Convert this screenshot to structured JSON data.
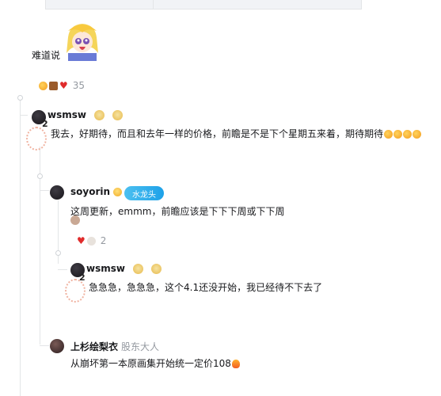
{
  "top_comment": {
    "text": "难道说",
    "reactions_count": "35"
  },
  "comments": [
    {
      "username": "wsmsw",
      "avatar_badge": "2",
      "text": "我去，好期待，而且和去年一样的价格，前瞻是不是下个星期五来着，期待期待"
    },
    {
      "username": "soyorin",
      "tag": "水龙头",
      "text": "这周更新，emmm，前瞻应该是下下下周或下下周",
      "reactions_count": "2"
    },
    {
      "username": "wsmsw",
      "avatar_badge": "2",
      "text": "急急急，急急急，这个4.1还没开始，我已经待不下去了"
    },
    {
      "username": "上杉绘梨衣",
      "title": "股东大人",
      "text": "从崩坏第一本原画集开始统一定价108"
    }
  ],
  "colors": {
    "tag_bg": "#1ea1e8",
    "muted": "#9499a0",
    "line": "#e3e5e7"
  }
}
